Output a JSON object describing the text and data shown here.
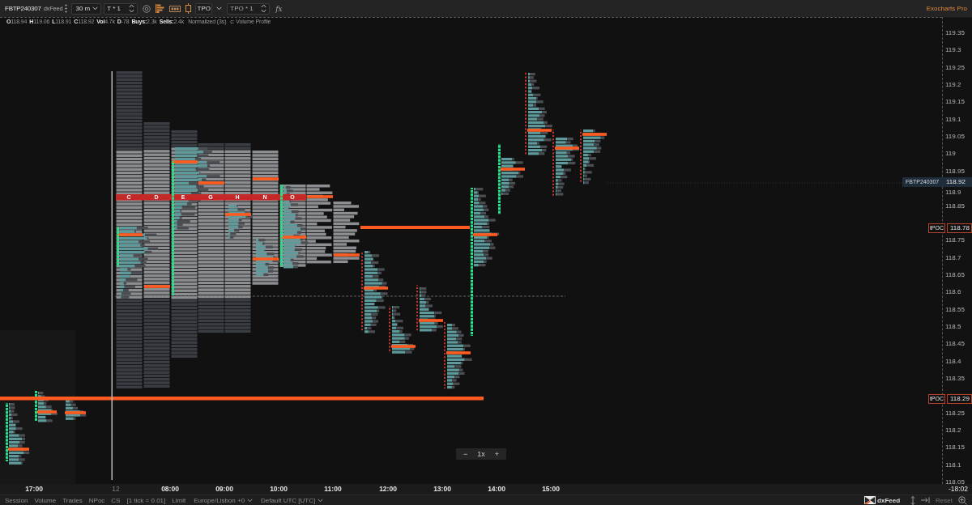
{
  "toolbar": {
    "symbol": "FBTP240307",
    "feed": "dxFeed",
    "timeframe": "30 m",
    "chart_type": "T * 1",
    "profile_type": "TPO",
    "profile_setting": "TPO * 1",
    "formula": "fx",
    "brand": "Exocharts Pro"
  },
  "info_line": {
    "stats": [
      {
        "label": "O",
        "value": "118.94"
      },
      {
        "label": "H",
        "value": "119.06"
      },
      {
        "label": "L",
        "value": "118.91"
      },
      {
        "label": "C",
        "value": "118.92"
      },
      {
        "label": "Vol",
        "value": "4.7k"
      },
      {
        "label": "D",
        "value": "-78"
      },
      {
        "label": "Buys:",
        "value": "2.3k"
      },
      {
        "label": "Sells:",
        "value": "2.4k"
      }
    ],
    "mode": "Normalized (3s)",
    "study": "c: Volume Profile"
  },
  "chart": {
    "tpo_poc_letters": [
      "C",
      "D",
      "E",
      "G",
      "H",
      "N",
      "O"
    ],
    "zoom_control": {
      "minus": "−",
      "level": "1x",
      "plus": "+"
    }
  },
  "price_axis": {
    "ticks": [
      "119.35",
      "119.3",
      "119.25",
      "119.2",
      "119.15",
      "119.1",
      "119.05",
      "119",
      "118.95",
      "118.9",
      "118.85",
      "118.75",
      "118.7",
      "118.65",
      "118.6",
      "118.55",
      "118.5",
      "118.45",
      "118.4",
      "118.35",
      "118.25",
      "118.2",
      "118.15",
      "118.1",
      "118.05"
    ],
    "markers": [
      {
        "kind": "last",
        "label": "FBTP240307",
        "price": "118.92"
      },
      {
        "kind": "tpoc",
        "label": "tPOC",
        "price": "118.78"
      },
      {
        "kind": "tpoc",
        "label": "tPOC",
        "price": "118.29"
      }
    ]
  },
  "time_axis": {
    "labels": [
      {
        "text": "17:00",
        "kind": "time"
      },
      {
        "text": "12",
        "kind": "date"
      },
      {
        "text": "08:00",
        "kind": "time"
      },
      {
        "text": "09:00",
        "kind": "time"
      },
      {
        "text": "10:00",
        "kind": "time"
      },
      {
        "text": "11:00",
        "kind": "time"
      },
      {
        "text": "12:00",
        "kind": "time"
      },
      {
        "text": "13:00",
        "kind": "time"
      },
      {
        "text": "14:00",
        "kind": "time"
      },
      {
        "text": "15:00",
        "kind": "time"
      }
    ],
    "countdown": "-18:02"
  },
  "status_bar": {
    "items": [
      {
        "text": "Session",
        "kind": "toggle"
      },
      {
        "text": "Volume",
        "kind": "toggle"
      },
      {
        "text": "Trades",
        "kind": "toggle"
      },
      {
        "text": "NPoc",
        "kind": "toggle"
      },
      {
        "text": "CS",
        "kind": "toggle"
      },
      {
        "text": "[1 tick = 0.01]",
        "kind": "info"
      },
      {
        "text": "Limit",
        "kind": "toggle"
      },
      {
        "text": "Europe/Lisbon +0",
        "kind": "dropdown"
      },
      {
        "text": "Default UTC [UTC]",
        "kind": "dropdown"
      }
    ],
    "feed": "dxFeed",
    "reset": "Reset"
  }
}
